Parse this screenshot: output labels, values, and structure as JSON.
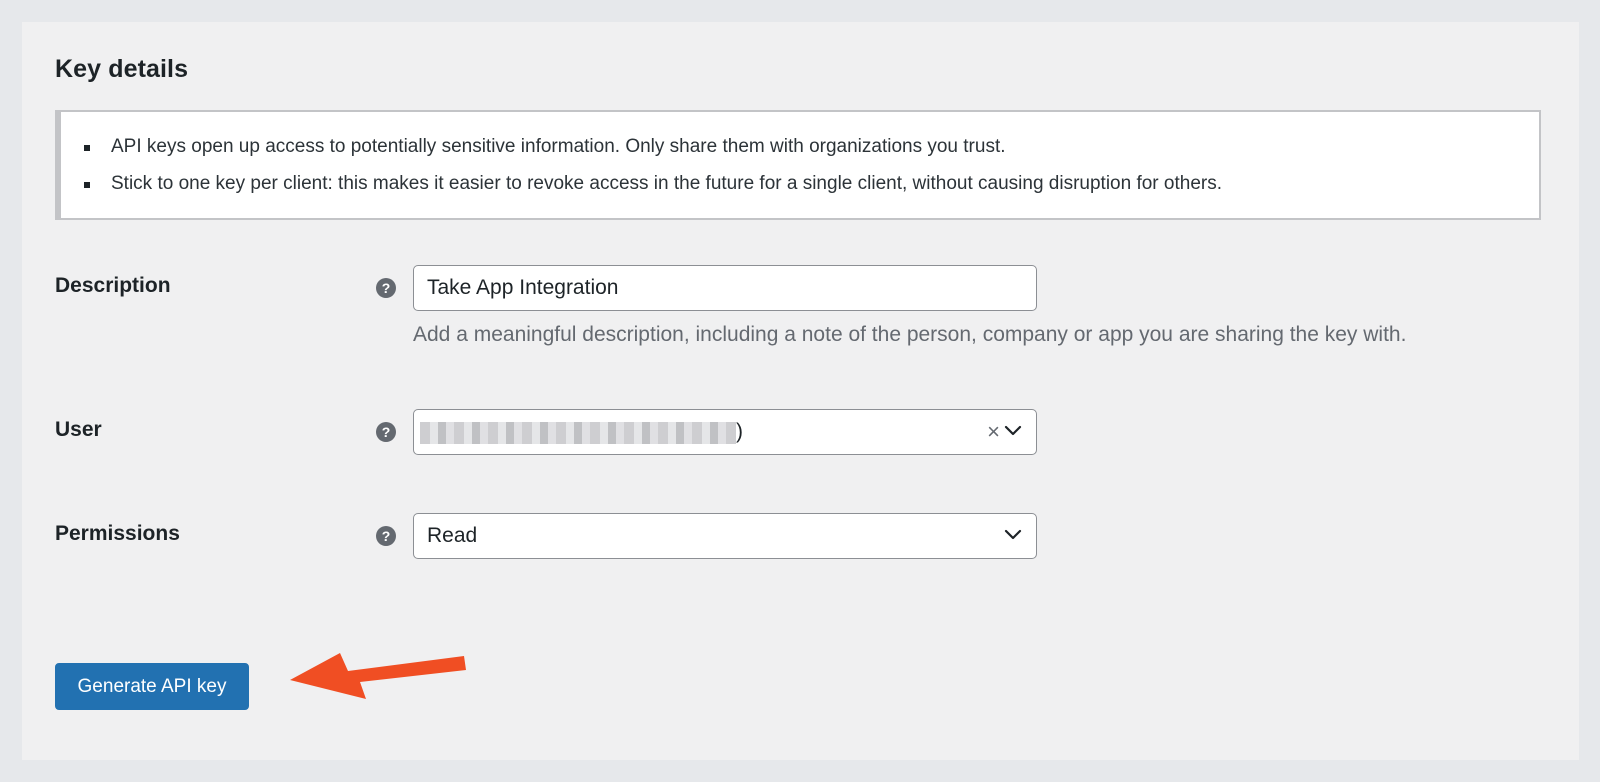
{
  "section_title": "Key details",
  "notice_items": [
    "API keys open up access to potentially sensitive information. Only share them with organizations you trust.",
    "Stick to one key per client: this makes it easier to revoke access in the future for a single client, without causing disruption for others."
  ],
  "description": {
    "label": "Description",
    "help": "?",
    "value": "Take App Integration",
    "help_text": "Add a meaningful description, including a note of the person, company or app you are sharing the key with."
  },
  "user": {
    "label": "User",
    "help": "?",
    "value_suffix": ")",
    "clear_glyph": "×"
  },
  "permissions": {
    "label": "Permissions",
    "help": "?",
    "value": "Read"
  },
  "generate_button": "Generate API key",
  "colors": {
    "primary_button": "#2271b1",
    "annotation_arrow": "#f04e23",
    "page_background": "#f0f0f1"
  }
}
